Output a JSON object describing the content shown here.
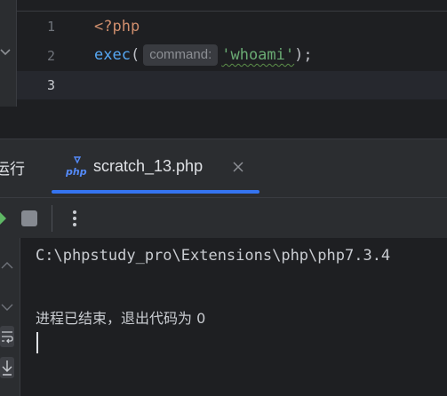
{
  "editor": {
    "line_numbers": [
      "1",
      "2",
      "3"
    ],
    "line1": {
      "open_tag": "<?php"
    },
    "line2": {
      "function": "exec",
      "paren_open": "(",
      "hint": "command:",
      "argument": "'whoami'",
      "close": ");"
    }
  },
  "run_panel": {
    "label": "运行",
    "tab": {
      "icon": "php-file-icon",
      "title": "scratch_13.php"
    },
    "toolbar": {
      "rerun_icon": "rerun-icon",
      "stop_icon": "stop-icon",
      "more_icon": "more-vertical-icon"
    },
    "console": {
      "command_line": "C:\\phpstudy_pro\\Extensions\\php\\php7.3.4",
      "exit_message": "进程已结束，退出代码为 0"
    }
  },
  "colors": {
    "accent": "#3574f0",
    "background": "#1e1f22",
    "panel": "#2b2d30",
    "keyword_tag": "#cf8e6d",
    "function": "#56a8f5",
    "string": "#6aab73"
  }
}
